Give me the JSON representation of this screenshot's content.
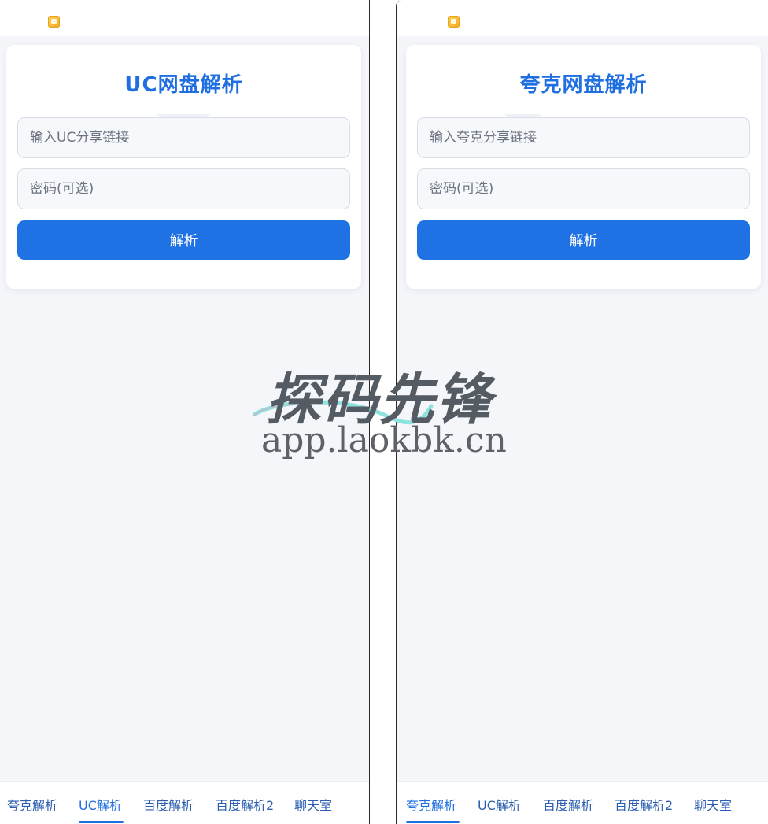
{
  "left_screen": {
    "title": "UC网盘解析",
    "link_placeholder": "输入UC分享链接",
    "password_placeholder": "密码(可选)",
    "parse_label": "解析",
    "tabs": [
      "夸克解析",
      "UC解析",
      "百度解析",
      "百度解析2",
      "聊天室"
    ],
    "active_tab": "UC解析"
  },
  "right_screen": {
    "title": "夸克网盘解析",
    "link_placeholder": "输入夸克分享链接",
    "password_placeholder": "密码(可选)",
    "parse_label": "解析",
    "tabs": [
      "夸克解析",
      "UC解析",
      "百度解析",
      "百度解析2",
      "聊天室"
    ],
    "active_tab": "夸克解析"
  },
  "watermark": {
    "brand": "探码先锋",
    "url": "app.laokbk.cn"
  },
  "colors": {
    "accent": "#1f72e4",
    "title": "#1f6fe0",
    "background": "#f4f6fa"
  }
}
